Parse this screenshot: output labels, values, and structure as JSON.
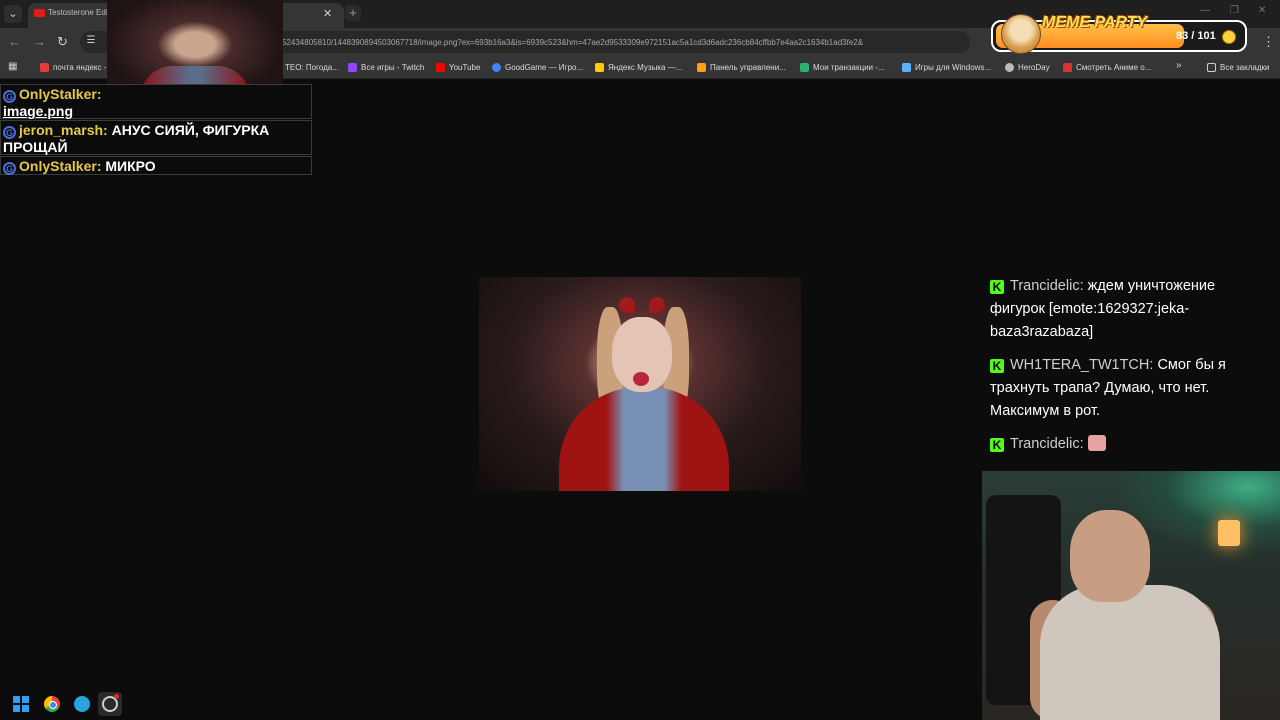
{
  "browser": {
    "tab_title": "Testosterone Edi",
    "url": "52434805810/1448390894503067718/image.png?ex=693b16a3&is=6939c523&hm=47ae2d9533309e972151ac5a1cd3d6adc236cb84cffbb7e4aa2c1634b1ad3fe2&",
    "bookmarks": [
      {
        "label": "почта яндекс -",
        "icon": "yandex-mail-icon",
        "color": "#e23b3b"
      },
      {
        "label": "ТЕО: Погода...",
        "icon": "weather-icon",
        "color": "#6d6d6d"
      },
      {
        "label": "Все игры - Twitch",
        "icon": "twitch-icon",
        "color": "#9146ff"
      },
      {
        "label": "YouTube",
        "icon": "youtube-icon",
        "color": "#ff0000"
      },
      {
        "label": "GoodGame — Игро...",
        "icon": "google-icon",
        "color": "#4285f4"
      },
      {
        "label": "Яндекс Музыка —...",
        "icon": "yandex-music-icon",
        "color": "#ffcc00"
      },
      {
        "label": "Панель управлени...",
        "icon": "panel-icon",
        "color": "#ff9f1c"
      },
      {
        "label": "Мои транзакции -...",
        "icon": "dmarket-icon",
        "color": "#27b36b"
      },
      {
        "label": "Игры для Windows...",
        "icon": "games-icon",
        "color": "#5ab2ff"
      },
      {
        "label": "HeroDay",
        "icon": "heroday-icon",
        "color": "#bbbbbb"
      },
      {
        "label": "Смотреть Аниме о...",
        "icon": "anime-icon",
        "color": "#d33"
      }
    ],
    "all_bookmarks": "Все закладки"
  },
  "left_chat": [
    {
      "user": "OnlyStalker:",
      "text": "image.png"
    },
    {
      "user": "jeron_marsh:",
      "text": "АНУС СИЯЙ, ФИГУРКА ПРОЩАЙ"
    },
    {
      "user": "OnlyStalker:",
      "text": "МИКРО"
    }
  ],
  "right_chat": [
    {
      "user": "Trancidelic:",
      "text": "ждем уничтожение фигурок [emote:1629327:jeka-baza3razabaza]"
    },
    {
      "user": "WH1TERA_TW1TCH:",
      "text": "Смог бы я трахнуть трапа? Думаю, что нет. Максимум в рот."
    },
    {
      "user": "Trancidelic:",
      "text": ""
    }
  ],
  "meme_party": {
    "title": "MEME PARTY",
    "count": "83 / 101",
    "progress": 0.82,
    "colors": {
      "fill": "#ff9f2a",
      "border": "#ffffff"
    }
  },
  "taskbar": [
    "windows-start-icon",
    "chrome-icon",
    "telegram-icon",
    "obs-icon"
  ]
}
